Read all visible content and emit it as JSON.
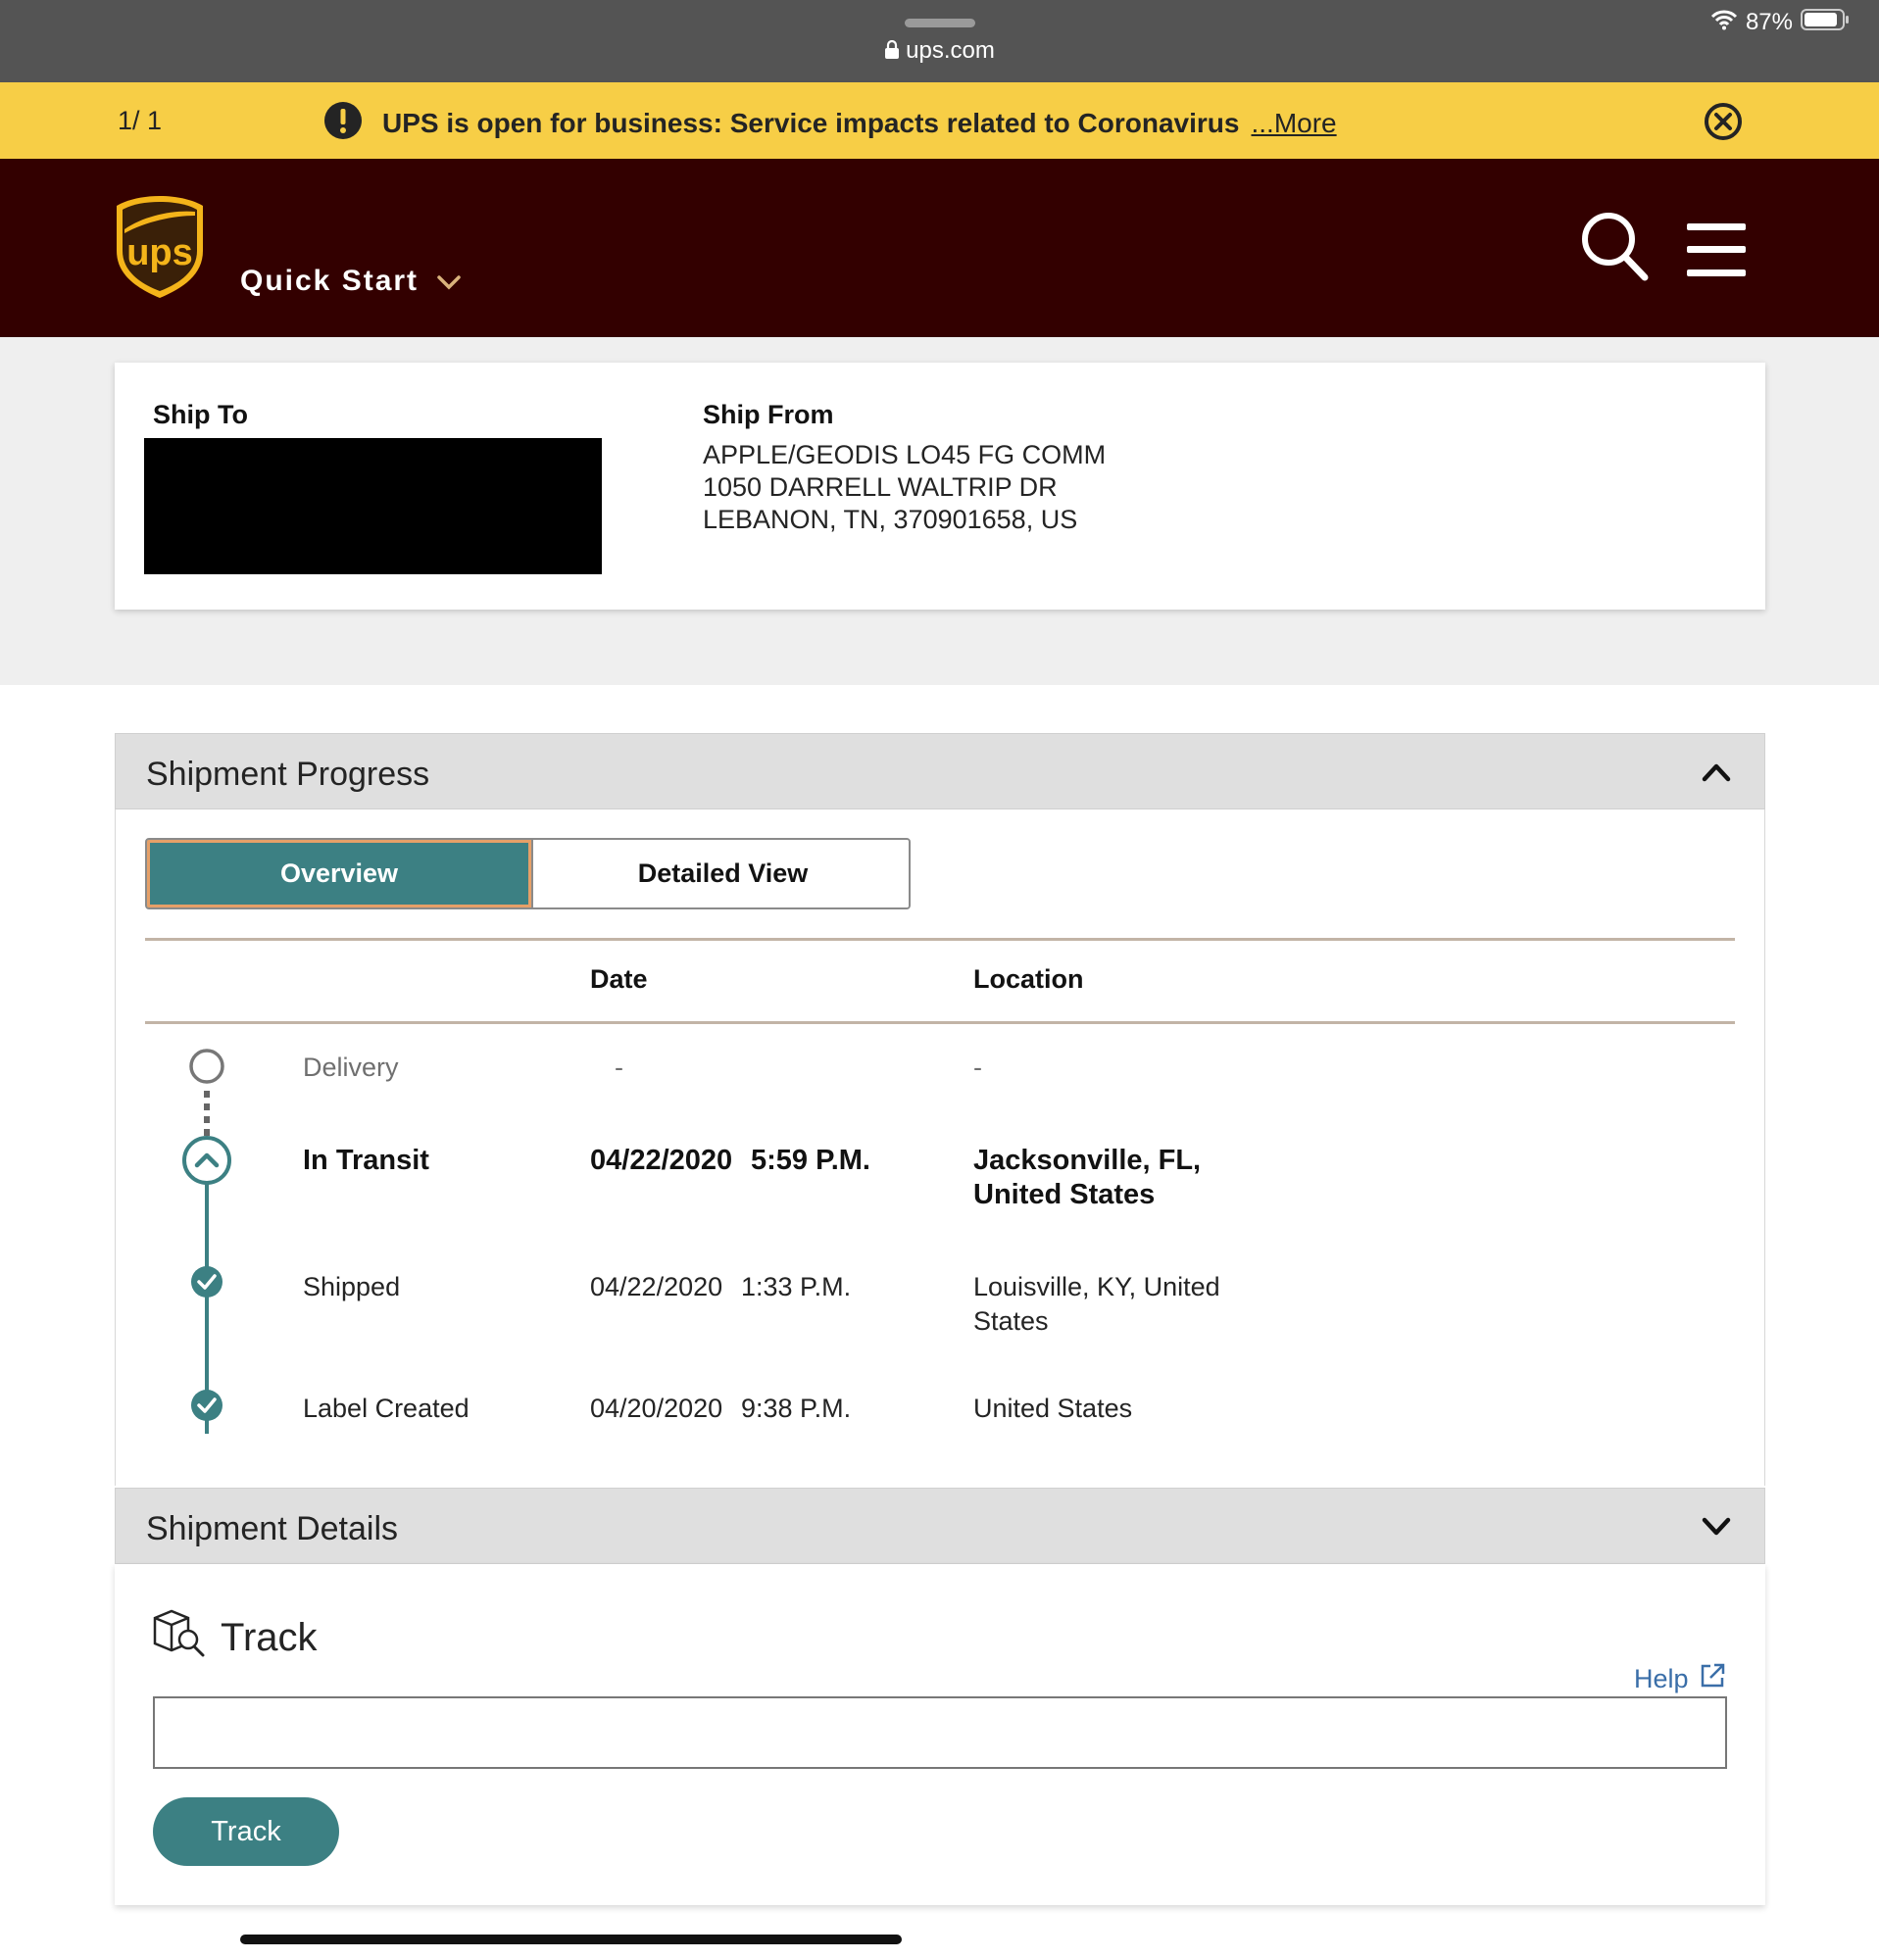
{
  "browser": {
    "url": "ups.com",
    "battery": "87%"
  },
  "alert": {
    "count": "1/ 1",
    "message": "UPS is open for business: Service impacts related to Coronavirus",
    "more_link": "...More"
  },
  "header": {
    "logo_text": "ups",
    "quick_start": "Quick Start"
  },
  "address": {
    "ship_to_label": "Ship To",
    "ship_from_label": "Ship From",
    "ship_from_lines": [
      "APPLE/GEODIS LO45 FG COMM",
      "1050 DARRELL WALTRIP DR",
      "LEBANON, TN, 370901658, US"
    ]
  },
  "progress": {
    "title": "Shipment Progress",
    "tabs": [
      {
        "label": "Overview",
        "active": true
      },
      {
        "label": "Detailed View",
        "active": false
      }
    ],
    "columns": {
      "date": "Date",
      "location": "Location"
    },
    "rows": [
      {
        "status": "Delivery",
        "date": "-",
        "time": "",
        "location": "-",
        "state": "pending"
      },
      {
        "status": "In Transit",
        "date": "04/22/2020",
        "time": "5:59 P.M.",
        "location": "Jacksonville, FL, United States",
        "state": "current"
      },
      {
        "status": "Shipped",
        "date": "04/22/2020",
        "time": "1:33 P.M.",
        "location": "Louisville, KY, United States",
        "state": "done"
      },
      {
        "status": "Label Created",
        "date": "04/20/2020",
        "time": "9:38 P.M.",
        "location": "United States",
        "state": "done"
      }
    ]
  },
  "details": {
    "title": "Shipment Details"
  },
  "track": {
    "title": "Track",
    "help": "Help",
    "input_value": "",
    "button": "Track"
  },
  "colors": {
    "ups_brown": "#330000",
    "alert_yellow": "#f7ce46",
    "teal": "#3c8083",
    "link_blue": "#3a6ea8"
  }
}
